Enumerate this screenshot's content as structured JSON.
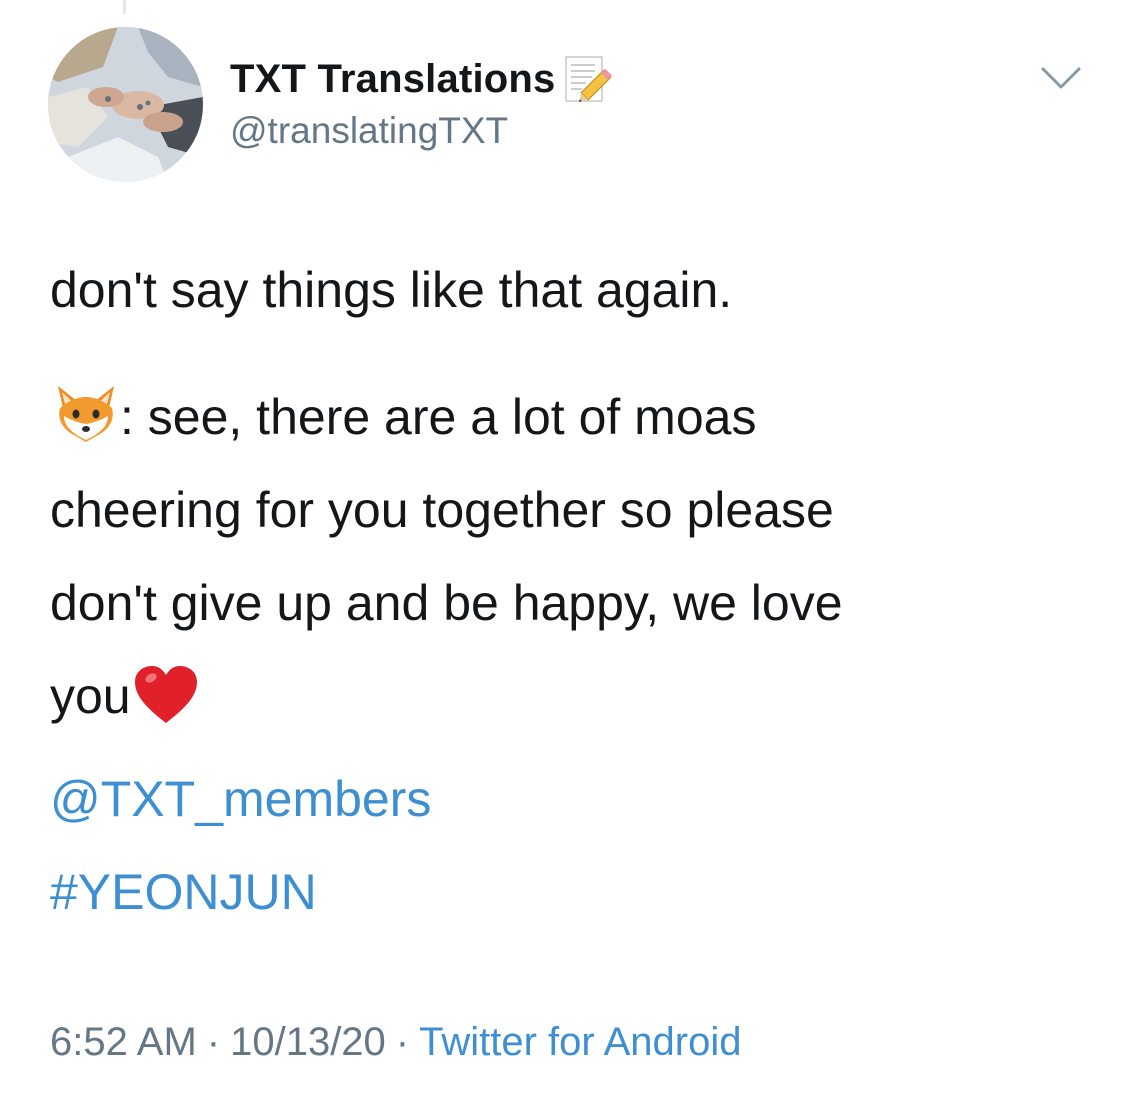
{
  "tweet": {
    "author": {
      "display_name": "TXT Translations",
      "handle": "@translatingTXT",
      "name_emoji": "memo-icon",
      "avatar": "profile-photo"
    },
    "more_menu_icon": "chevron-down-icon",
    "text": {
      "line1": "don't say things like that again.",
      "speaker_emoji": "fox-face-icon",
      "body_rows": [
        ": see, there are a lot of moas",
        "cheering for you together so please",
        "don't give up and be happy, we love",
        "you"
      ],
      "trailing_emoji": "red-heart-icon"
    },
    "mention": "@TXT_members",
    "hashtag": "#YEONJUN",
    "meta": {
      "time": "6:52 AM",
      "separator": "·",
      "date": "10/13/20",
      "source": "Twitter for Android"
    },
    "colors": {
      "text": "#14171a",
      "secondary": "#657786",
      "link": "#3d8fd1"
    }
  }
}
